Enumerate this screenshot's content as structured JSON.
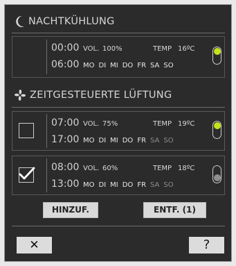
{
  "colors": {
    "panel_bg": "#2b2b2b",
    "toggle_on": "#c6e21b",
    "toggle_off": "#8f8f8f",
    "text": "#d6d6d6",
    "button_bg": "#d9d9d9"
  },
  "night_cooling": {
    "icon": "moon-icon",
    "title": "NACHTKÜHLUNG",
    "entry": {
      "start_time": "00:00",
      "end_time": "06:00",
      "vol_label": "VOL.",
      "vol_value": "100%",
      "temp_label": "TEMP",
      "temp_value": "16ºC",
      "days": [
        "MO",
        "DI",
        "MI",
        "DO",
        "FR",
        "SA",
        "SO"
      ],
      "toggle": "on"
    }
  },
  "timed_ventilation": {
    "icon": "fan-icon",
    "title": "ZEITGESTEUERTE LÜFTUNG",
    "entries": [
      {
        "checked": false,
        "start_time": "07:00",
        "end_time": "17:00",
        "vol_label": "VOL.",
        "vol_value": "75%",
        "temp_label": "TEMP",
        "temp_value": "19ºC",
        "days": [
          "MO",
          "DI",
          "MI",
          "DO",
          "FR",
          "SA",
          "SO"
        ],
        "days_active": [
          true,
          true,
          true,
          true,
          true,
          false,
          false
        ],
        "toggle": "on"
      },
      {
        "checked": true,
        "start_time": "08:00",
        "end_time": "13:00",
        "vol_label": "VOL.",
        "vol_value": "60%",
        "temp_label": "TEMP",
        "temp_value": "18ºC",
        "days": [
          "MO",
          "DI",
          "MI",
          "DO",
          "FR",
          "SA",
          "SO"
        ],
        "days_active": [
          true,
          true,
          true,
          true,
          true,
          false,
          false
        ],
        "toggle": "off"
      }
    ]
  },
  "actions": {
    "add_label": "HINZUF.",
    "remove_label": "ENTF. (1)"
  },
  "footer": {
    "close_label": "✕",
    "help_label": "?"
  }
}
